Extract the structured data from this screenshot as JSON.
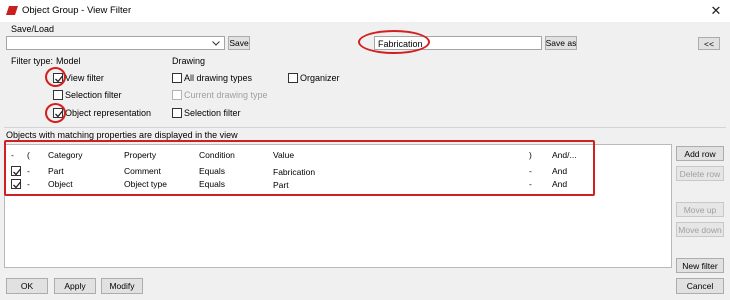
{
  "window": {
    "title": "Object Group - View Filter",
    "close_glyph": "✕"
  },
  "save_load": {
    "label": "Save/Load",
    "combo_value": "",
    "save_label": "Save",
    "name_value": "Fabrication",
    "save_as_label": "Save as",
    "collapse_label": "<<"
  },
  "filter_type": {
    "label": "Filter type:",
    "model_label": "Model",
    "drawing_label": "Drawing",
    "options": {
      "view_filter": {
        "label": "View filter",
        "checked": true
      },
      "selection_filter": {
        "label": "Selection filter",
        "checked": false
      },
      "object_representation": {
        "label": "Object representation",
        "checked": true
      },
      "all_drawing_types": {
        "label": "All drawing types",
        "checked": false
      },
      "current_drawing_type": {
        "label": "Current drawing type",
        "checked": false,
        "enabled": false
      },
      "drawing_selection_filter": {
        "label": "Selection filter",
        "checked": false
      },
      "organizer": {
        "label": "Organizer",
        "checked": false
      }
    }
  },
  "objects_note": "Objects with matching properties are displayed in the view",
  "grid": {
    "headers": [
      "-",
      "(",
      "Category",
      "Property",
      "Condition",
      "Value",
      ")",
      "And/..."
    ],
    "rows": [
      {
        "checked": true,
        "dash": "-",
        "category": "Part",
        "property": "Comment",
        "condition": "Equals",
        "value": "Fabrication",
        "close_paren": "-",
        "and_or": "And"
      },
      {
        "checked": true,
        "dash": "-",
        "category": "Object",
        "property": "Object type",
        "condition": "Equals",
        "value": "Part",
        "close_paren": "-",
        "and_or": "And"
      }
    ]
  },
  "side_buttons": {
    "add_row": "Add row",
    "delete_row": "Delete row",
    "move_up": "Move up",
    "move_down": "Move down",
    "new_filter": "New filter"
  },
  "bottom_buttons": {
    "ok": "OK",
    "apply": "Apply",
    "modify": "Modify",
    "cancel": "Cancel"
  },
  "colors": {
    "annotation_red": "#d21f1f",
    "app_icon_red": "#c8201e"
  }
}
